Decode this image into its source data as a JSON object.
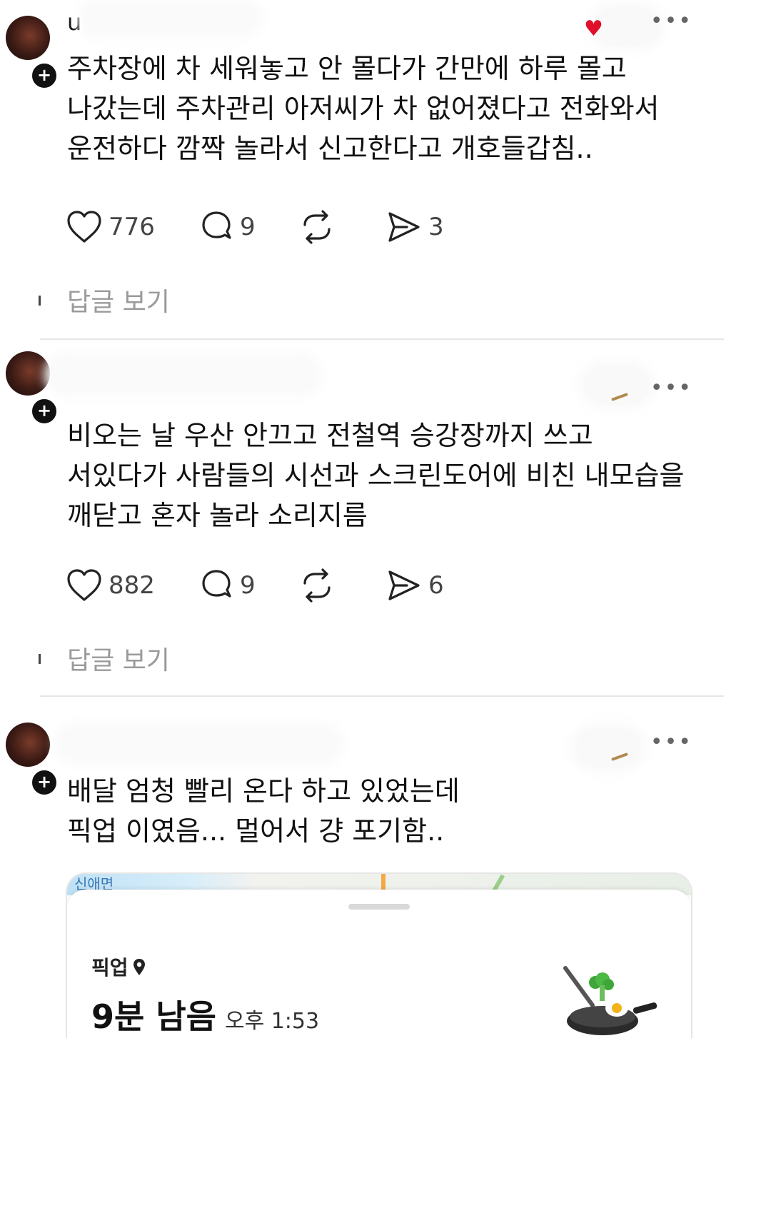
{
  "posts": [
    {
      "username": "u",
      "text_lines": [
        "주차장에 차 세워놓고 안 몰다가 간만에 하루 몰고",
        "나갔는데 주차관리 아저씨가 차 없어졌다고 전화와서",
        "운전하다 깜짝 놀라서 신고한다고 개호들갑침.."
      ],
      "likes": "776",
      "comments": "9",
      "reposts": "",
      "shares": "3",
      "view_replies": "답글 보기"
    },
    {
      "username": "",
      "text_lines": [
        "비오는 날 우산 안끄고 전철역 승강장까지 쓰고",
        "서있다가 사람들의 시선과 스크린도어에 비친 내모습을",
        "깨닫고 혼자 놀라 소리지름"
      ],
      "likes": "882",
      "comments": "9",
      "reposts": "",
      "shares": "6",
      "view_replies": "답글 보기"
    },
    {
      "username": "",
      "text_lines": [
        "배달 엄청 빨리 온다 하고 있었는데",
        "픽업 이였음... 멀어서 걍 포기함.."
      ],
      "embed": {
        "map_label": "신애면",
        "pickup_label": "픽업",
        "eta": "9분 남음",
        "eta_time": "오후 1:53"
      }
    }
  ],
  "icons": {
    "like": "heart-icon",
    "comment": "comment-icon",
    "repost": "repost-icon",
    "share": "send-icon",
    "more": "more-icon",
    "pin": "location-pin-icon"
  },
  "more_glyph": "•••"
}
